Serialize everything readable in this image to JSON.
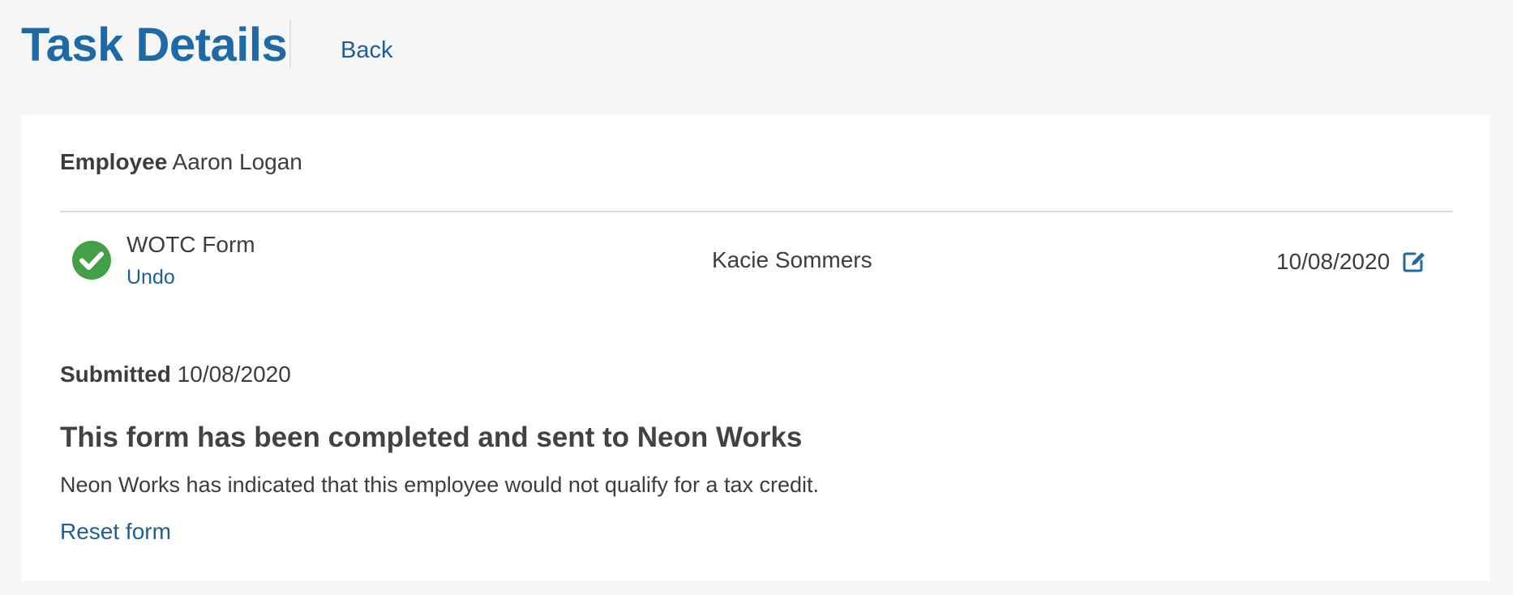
{
  "header": {
    "title": "Task Details",
    "back_label": "Back"
  },
  "employee": {
    "label": "Employee",
    "name": "Aaron Logan"
  },
  "task": {
    "name": "WOTC Form",
    "undo_label": "Undo",
    "assignee": "Kacie Sommers",
    "date": "10/08/2020",
    "status_icon": "check-circle-icon",
    "edit_icon": "edit-icon"
  },
  "submission": {
    "label": "Submitted",
    "date": "10/08/2020",
    "heading": "This form has been completed and sent to Neon Works",
    "message": "Neon Works has indicated that this employee would not qualify for a tax credit.",
    "reset_label": "Reset form"
  },
  "colors": {
    "brand": "#1f6aa5",
    "link": "#1f5f99",
    "success": "#43a047",
    "page_background": "#f6f6f6",
    "card_background": "#ffffff",
    "text": "#3d3d3d"
  }
}
